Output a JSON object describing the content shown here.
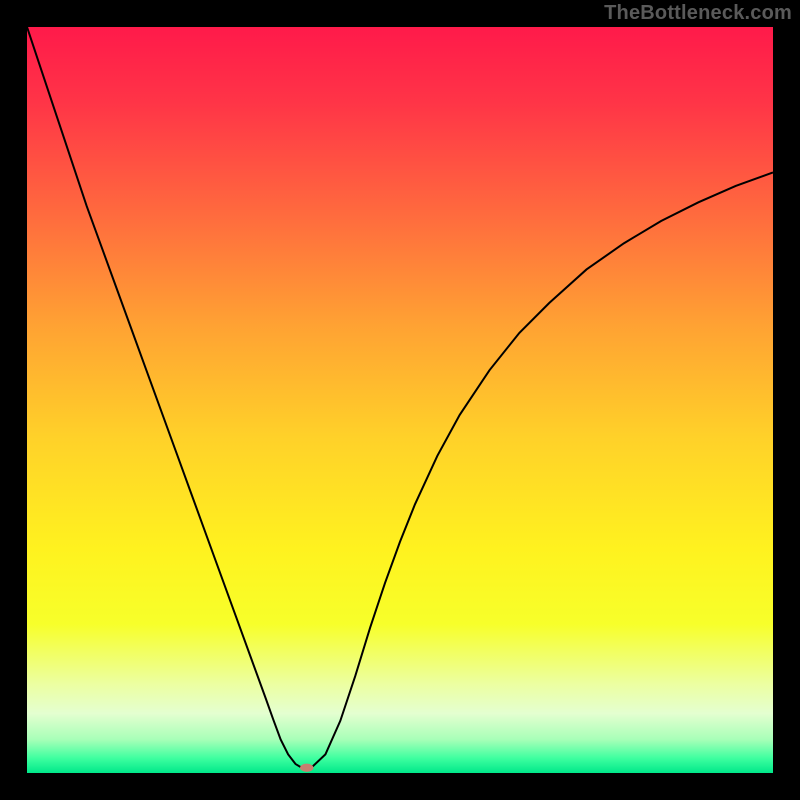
{
  "watermark": "TheBottleneck.com",
  "chart_data": {
    "type": "line",
    "title": "",
    "xlabel": "",
    "ylabel": "",
    "xlim": [
      0,
      100
    ],
    "ylim": [
      0,
      100
    ],
    "curve_x": [
      0,
      2,
      4,
      6,
      8,
      10,
      12,
      14,
      16,
      18,
      20,
      22,
      24,
      26,
      28,
      30,
      32,
      33,
      34,
      35,
      36,
      37,
      38,
      40,
      42,
      44,
      46,
      48,
      50,
      52,
      55,
      58,
      62,
      66,
      70,
      75,
      80,
      85,
      90,
      95,
      100
    ],
    "curve_y": [
      100,
      94,
      88,
      82,
      76,
      70.5,
      65,
      59.5,
      54,
      48.5,
      43,
      37.5,
      32,
      26.5,
      21,
      15.5,
      10,
      7.2,
      4.5,
      2.5,
      1.2,
      0.6,
      0.6,
      2.5,
      7,
      13,
      19.5,
      25.5,
      31,
      36,
      42.5,
      48,
      54,
      59,
      63,
      67.5,
      71,
      74,
      76.5,
      78.7,
      80.5
    ],
    "minimum_point_x": 37.5,
    "gradient_stops": [
      {
        "pos": 0.0,
        "color": "#ff1a4a"
      },
      {
        "pos": 0.1,
        "color": "#ff3447"
      },
      {
        "pos": 0.25,
        "color": "#ff6a3e"
      },
      {
        "pos": 0.4,
        "color": "#ffa233"
      },
      {
        "pos": 0.55,
        "color": "#ffd129"
      },
      {
        "pos": 0.7,
        "color": "#fff21f"
      },
      {
        "pos": 0.8,
        "color": "#f7ff2a"
      },
      {
        "pos": 0.88,
        "color": "#ecffa0"
      },
      {
        "pos": 0.92,
        "color": "#e4ffd0"
      },
      {
        "pos": 0.955,
        "color": "#a8ffb8"
      },
      {
        "pos": 0.98,
        "color": "#3fffa0"
      },
      {
        "pos": 1.0,
        "color": "#00e88a"
      }
    ],
    "marker": {
      "x": 37.5,
      "y": 0.7,
      "color": "#c88070"
    }
  }
}
